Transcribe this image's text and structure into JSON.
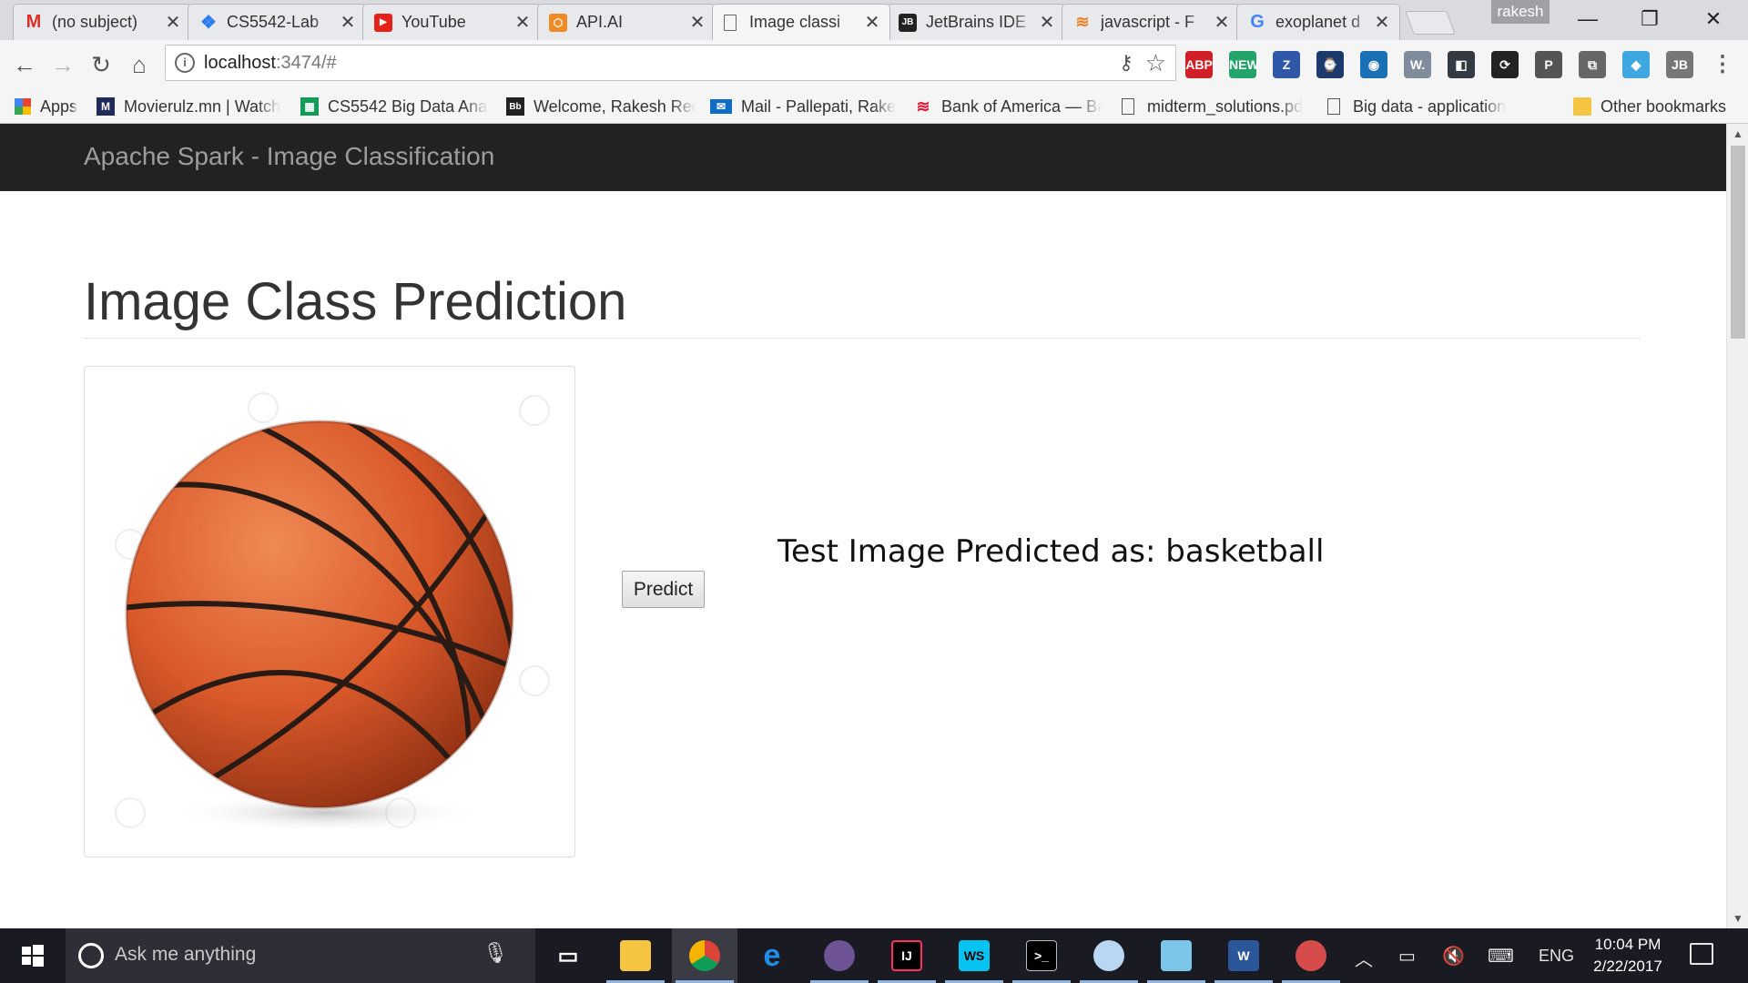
{
  "browser": {
    "tabs": [
      {
        "title": "(no subject)",
        "icon": "gmail-icon"
      },
      {
        "title": "CS5542-Lab",
        "icon": "dropbox-icon"
      },
      {
        "title": "YouTube",
        "icon": "youtube-icon"
      },
      {
        "title": "API.AI",
        "icon": "apiai-icon"
      },
      {
        "title": "Image classi",
        "icon": "document-icon",
        "active": true
      },
      {
        "title": "JetBrains IDE",
        "icon": "jetbrains-icon"
      },
      {
        "title": "javascript - F",
        "icon": "stackoverflow-icon"
      },
      {
        "title": "exoplanet d",
        "icon": "google-icon"
      }
    ],
    "profile_name": "rakesh",
    "window_controls": {
      "minimize": "—",
      "restore": "❐",
      "close": "✕"
    },
    "url_host": "localhost",
    "url_rest": ":3474/#",
    "extensions": [
      {
        "name": "adblock-plus-icon",
        "label": "ABP",
        "color": "#d01f26"
      },
      {
        "name": "new-extension-icon",
        "label": "NEW",
        "color": "#24a46b"
      },
      {
        "name": "zotero-icon",
        "label": "Z",
        "color": "#3058a8"
      },
      {
        "name": "speedtest-icon",
        "label": "⌚",
        "color": "#1b3a6b"
      },
      {
        "name": "eye-extension-icon",
        "label": "◉",
        "color": "#1b6fb5"
      },
      {
        "name": "wappalyzer-icon",
        "label": "W.",
        "color": "#7f8c9b"
      },
      {
        "name": "vs-extension-icon",
        "label": "◧",
        "color": "#333a44"
      },
      {
        "name": "sync-extension-icon",
        "label": "⟳",
        "color": "#222"
      },
      {
        "name": "pushbullet-icon",
        "label": "P",
        "color": "#555"
      },
      {
        "name": "cast-icon",
        "label": "⧉",
        "color": "#666"
      },
      {
        "name": "edge-ext-icon",
        "label": "◆",
        "color": "#3fa7e0"
      },
      {
        "name": "jetbrains-ext-icon",
        "label": "JB",
        "color": "#777"
      },
      {
        "name": "chrome-menu-icon",
        "label": "⋮",
        "color": "#555"
      }
    ]
  },
  "bookmarks": [
    {
      "label": "Apps",
      "icon": "apps-grid-icon"
    },
    {
      "label": "Movierulz.mn | Watch",
      "icon": "movierulz-icon"
    },
    {
      "label": "CS5542 Big Data Anal",
      "icon": "sheets-icon"
    },
    {
      "label": "Welcome, Rakesh Red",
      "icon": "blackboard-icon"
    },
    {
      "label": "Mail - Pallepati, Rakes",
      "icon": "mail-icon"
    },
    {
      "label": "Bank of America — Ba",
      "icon": "bank-of-america-icon"
    },
    {
      "label": "midterm_solutions.pd",
      "icon": "document-icon"
    },
    {
      "label": "Big data - application",
      "icon": "document-icon"
    },
    {
      "label": "Other bookmarks",
      "icon": "folder-icon"
    }
  ],
  "page": {
    "brand": "Apache Spark - Image Classification",
    "heading": "Image Class Prediction",
    "predict_button": "Predict",
    "result_text": "Test Image Predicted as: basketball"
  },
  "taskbar": {
    "search_placeholder": "Ask me anything",
    "apps": [
      {
        "name": "task-view-icon",
        "label": "▭"
      },
      {
        "name": "file-explorer-icon",
        "label": ""
      },
      {
        "name": "chrome-icon",
        "label": ""
      },
      {
        "name": "edge-icon",
        "label": "e"
      },
      {
        "name": "github-icon",
        "label": ""
      },
      {
        "name": "intellij-icon",
        "label": "IJ"
      },
      {
        "name": "webstorm-icon",
        "label": "WS"
      },
      {
        "name": "terminal-icon",
        "label": ">_"
      },
      {
        "name": "paint-icon",
        "label": ""
      },
      {
        "name": "notepad-icon",
        "label": ""
      },
      {
        "name": "word-icon",
        "label": "W"
      },
      {
        "name": "snipping-tool-icon",
        "label": ""
      }
    ],
    "language": "ENG",
    "time": "10:04 PM",
    "date": "2/22/2017"
  }
}
